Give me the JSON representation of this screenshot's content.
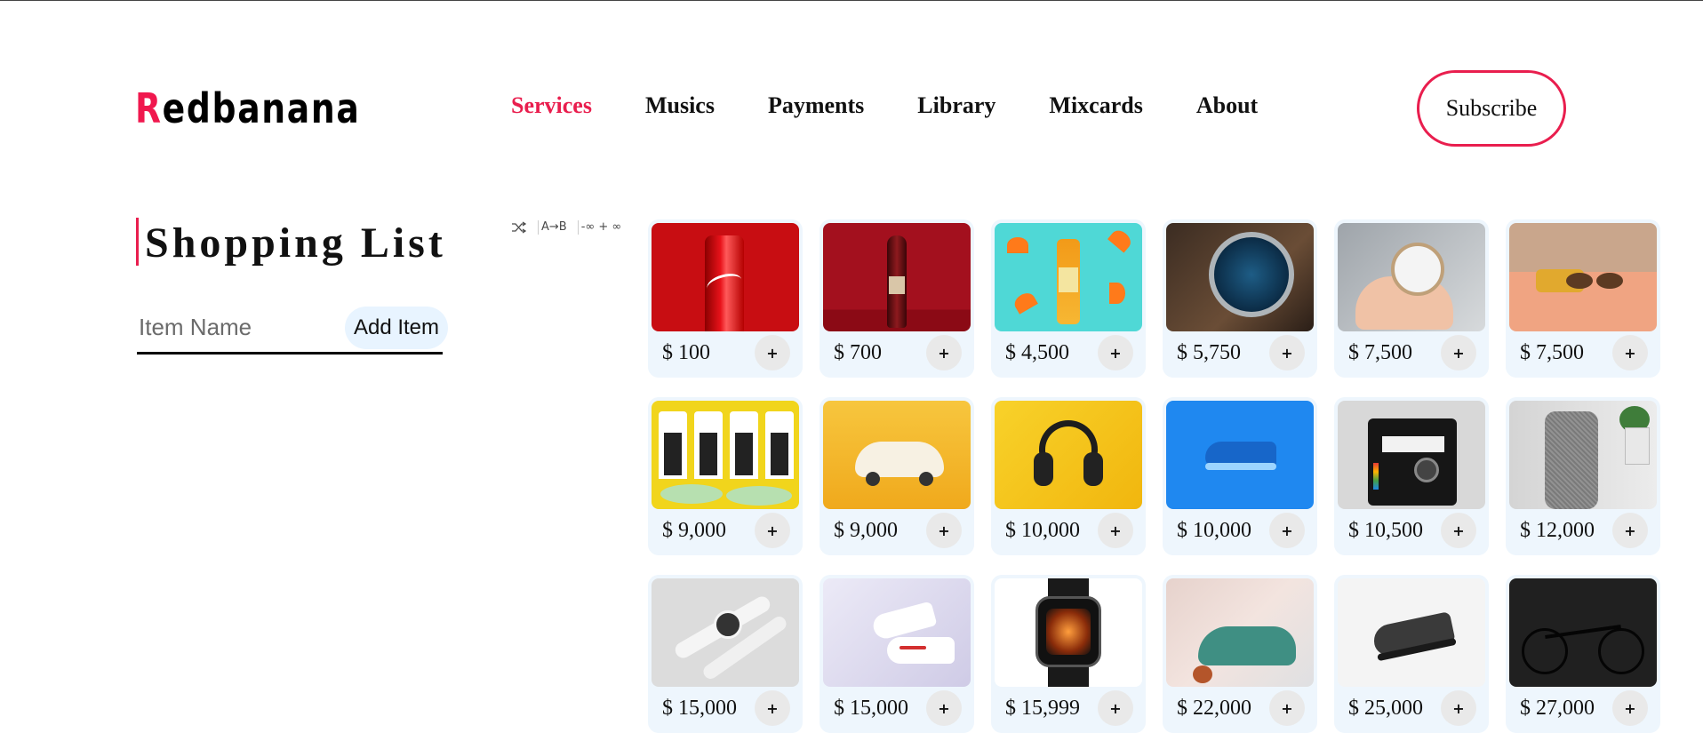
{
  "header": {
    "logo_first": "R",
    "logo_rest": "edbanana",
    "nav": [
      {
        "label": "Services",
        "active": true
      },
      {
        "label": "Musics",
        "active": false
      },
      {
        "label": "Payments",
        "active": false
      },
      {
        "label": "Library",
        "active": false
      },
      {
        "label": "Mixcards",
        "active": false
      },
      {
        "label": "About",
        "active": false
      }
    ],
    "subscribe_label": "Subscribe"
  },
  "shopping_list": {
    "title": "Shopping List",
    "input_placeholder": "Item Name",
    "input_value": "",
    "add_button_label": "Add Item"
  },
  "tools": {
    "shuffle_icon": "shuffle-icon",
    "sort_az_label": "A→B",
    "range_label": "-∞ + ∞"
  },
  "products": [
    {
      "price": "$ 100",
      "image": "coca-cola-can",
      "add_label": "+"
    },
    {
      "price": "$ 700",
      "image": "red-soda-bottle",
      "add_label": "+"
    },
    {
      "price": "$ 4,500",
      "image": "orange-juice-bottle",
      "add_label": "+"
    },
    {
      "price": "$ 5,750",
      "image": "blue-wristwatch",
      "add_label": "+"
    },
    {
      "price": "$ 7,500",
      "image": "hand-holding-watch",
      "add_label": "+"
    },
    {
      "price": "$ 7,500",
      "image": "sunglasses-on-table",
      "add_label": "+"
    },
    {
      "price": "$ 9,000",
      "image": "boxed-water-cartons",
      "add_label": "+"
    },
    {
      "price": "$ 9,000",
      "image": "toy-car",
      "add_label": "+"
    },
    {
      "price": "$ 10,000",
      "image": "headphones",
      "add_label": "+"
    },
    {
      "price": "$ 10,000",
      "image": "blue-sneaker",
      "add_label": "+"
    },
    {
      "price": "$ 10,500",
      "image": "polaroid-camera",
      "add_label": "+"
    },
    {
      "price": "$ 12,000",
      "image": "smart-speaker",
      "add_label": "+"
    },
    {
      "price": "$ 15,000",
      "image": "white-smartwatches",
      "add_label": "+"
    },
    {
      "price": "$ 15,000",
      "image": "white-sneakers",
      "add_label": "+"
    },
    {
      "price": "$ 15,999",
      "image": "apple-watch",
      "add_label": "+"
    },
    {
      "price": "$ 22,000",
      "image": "green-shoe",
      "add_label": "+"
    },
    {
      "price": "$ 25,000",
      "image": "black-running-shoe",
      "add_label": "+"
    },
    {
      "price": "$ 27,000",
      "image": "black-bicycle",
      "add_label": "+"
    }
  ],
  "colors": {
    "accent": "#e91e4e",
    "card_bg": "#eef6fd",
    "add_button_bg": "#e8f4ff"
  }
}
